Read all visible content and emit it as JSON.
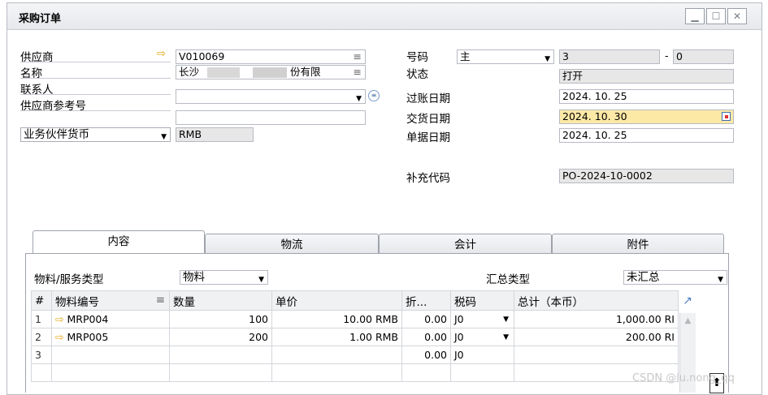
{
  "window": {
    "title": "采购订单"
  },
  "header": {
    "vendor_label": "供应商",
    "vendor_value": "V010069",
    "name_label": "名称",
    "name_value_start": "长沙",
    "name_value_end": "份有限",
    "contact_label": "联系人",
    "contact_value": "",
    "vendor_ref_label": "供应商参考号",
    "vendor_ref_value": "",
    "currency_label": "业务伙伴货币",
    "currency_value": "RMB",
    "number_label": "号码",
    "series_value": "主",
    "number_value": "3",
    "number_dash": "-",
    "number_suffix": "0",
    "status_label": "状态",
    "status_value": "打开",
    "posting_label": "过账日期",
    "posting_value": "2024. 10. 25",
    "delivery_label": "交货日期",
    "delivery_value": "2024. 10. 30",
    "doc_date_label": "单据日期",
    "doc_date_value": "2024. 10. 25",
    "supp_code_label": "补充代码",
    "supp_code_value": "PO-2024-10-0002"
  },
  "tabs": [
    "内容",
    "物流",
    "会计",
    "附件"
  ],
  "content": {
    "item_type_label": "物料/服务类型",
    "item_type_value": "物料",
    "summary_type_label": "汇总类型",
    "summary_type_value": "未汇总"
  },
  "grid": {
    "columns": [
      "#",
      "物料编号",
      "数量",
      "单价",
      "折...",
      "税码",
      "总计（本币）"
    ],
    "rows": [
      {
        "no": "1",
        "item": "MRP004",
        "qty": "100",
        "price": "10.00 RMB",
        "disc": "0.00",
        "tax": "J0",
        "total": "1,000.00 RI"
      },
      {
        "no": "2",
        "item": "MRP005",
        "qty": "200",
        "price": "1.00 RMB",
        "disc": "0.00",
        "tax": "J0",
        "total": "200.00 RI"
      },
      {
        "no": "3",
        "item": "",
        "qty": "",
        "price": "",
        "disc": "0.00",
        "tax": "J0",
        "total": ""
      }
    ]
  },
  "watermark": "CSDN @lu.nong_qq"
}
